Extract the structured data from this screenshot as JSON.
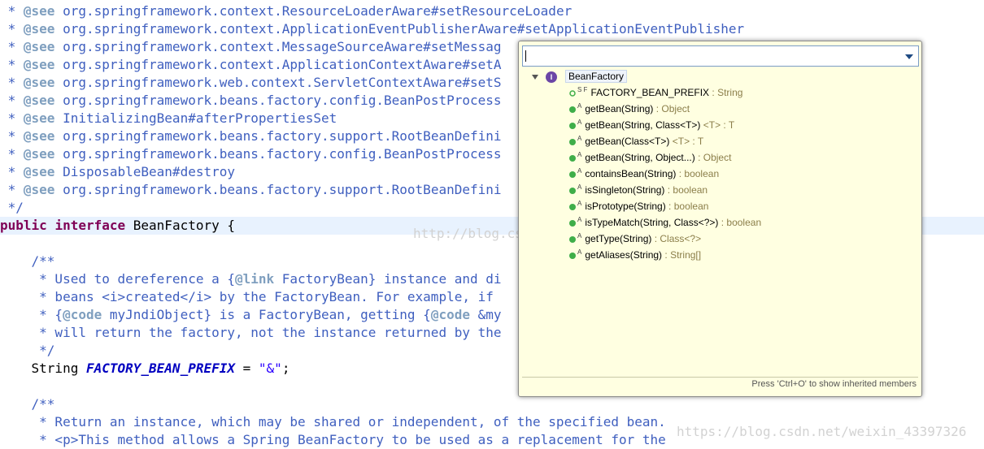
{
  "editor": {
    "see_prefix": " * ",
    "see_tag": "@see",
    "see_lines": [
      " org.springframework.context.ResourceLoaderAware#setResourceLoader",
      " org.springframework.context.ApplicationEventPublisherAware#setApplicationEventPublisher",
      " org.springframework.context.MessageSourceAware#setMessag",
      " org.springframework.context.ApplicationContextAware#setA",
      " org.springframework.web.context.ServletContextAware#setS",
      " org.springframework.beans.factory.config.BeanPostProcess",
      " InitializingBean#afterPropertiesSet",
      " org.springframework.beans.factory.support.RootBeanDefini",
      " org.springframework.beans.factory.config.BeanPostProcess",
      " DisposableBean#destroy",
      " org.springframework.beans.factory.support.RootBeanDefini"
    ],
    "comment_end": " */",
    "decl_public": "public",
    "decl_interface": "interface",
    "decl_name": " BeanFactory {",
    "doc1_open": "    /**",
    "doc1_l1_a": "     * Used to dereference a {",
    "doc1_l1_link": "@link",
    "doc1_l1_b": " FactoryBean} instance and di",
    "doc1_l2": "     * beans <i>created</i> by the FactoryBean. For example, if",
    "doc1_l3_a": "     * {",
    "doc1_l3_code1": "@code",
    "doc1_l3_b": " myJndiObject} is a FactoryBean, getting {",
    "doc1_l3_code2": "@code",
    "doc1_l3_c": " &my",
    "doc1_l4": "     * will return the factory, not the instance returned by the",
    "doc1_close": "     */",
    "field_type": "    String ",
    "field_name": "FACTORY_BEAN_PREFIX",
    "field_eq": " = ",
    "field_value": "\"&\"",
    "field_semi": ";",
    "doc2_open": "    /**",
    "doc2_l1": "     * Return an instance, which may be shared or independent, of the specified bean.",
    "doc2_l2": "     * <p>This method allows a Spring BeanFactory to be used as a replacement for the"
  },
  "outline": {
    "filter_value": "",
    "root_label": "BeanFactory",
    "members": [
      {
        "name": "FACTORY_BEAN_PREFIX",
        "type": " : String",
        "modifiers": "S F",
        "kind": "field"
      },
      {
        "name": "getBean(String)",
        "type": " : Object",
        "modifiers": "A",
        "kind": "method"
      },
      {
        "name": "getBean(String, Class<T>)",
        "type": " <T> : T",
        "modifiers": "A",
        "kind": "method"
      },
      {
        "name": "getBean(Class<T>)",
        "type": " <T> : T",
        "modifiers": "A",
        "kind": "method"
      },
      {
        "name": "getBean(String, Object...)",
        "type": " : Object",
        "modifiers": "A",
        "kind": "method"
      },
      {
        "name": "containsBean(String)",
        "type": " : boolean",
        "modifiers": "A",
        "kind": "method"
      },
      {
        "name": "isSingleton(String)",
        "type": " : boolean",
        "modifiers": "A",
        "kind": "method"
      },
      {
        "name": "isPrototype(String)",
        "type": " : boolean",
        "modifiers": "A",
        "kind": "method"
      },
      {
        "name": "isTypeMatch(String, Class<?>)",
        "type": " : boolean",
        "modifiers": "A",
        "kind": "method"
      },
      {
        "name": "getType(String)",
        "type": " : Class<?>",
        "modifiers": "A",
        "kind": "method"
      },
      {
        "name": "getAliases(String)",
        "type": " : String[]",
        "modifiers": "A",
        "kind": "method"
      }
    ],
    "footer": "Press 'Ctrl+O' to show inherited members"
  },
  "watermarks": {
    "center": "http://blog.csdn.net/",
    "bottom": "https://blog.csdn.net/weixin_43397326"
  },
  "colors": {
    "keyword": "#7f0055",
    "javadoc": "#3f5fbf",
    "javadoc_tag": "#7f9fbf",
    "field": "#0000c0",
    "string": "#2a00ff",
    "outline_bg": "#ffffe1",
    "public_method_dot": "#3fae49"
  }
}
